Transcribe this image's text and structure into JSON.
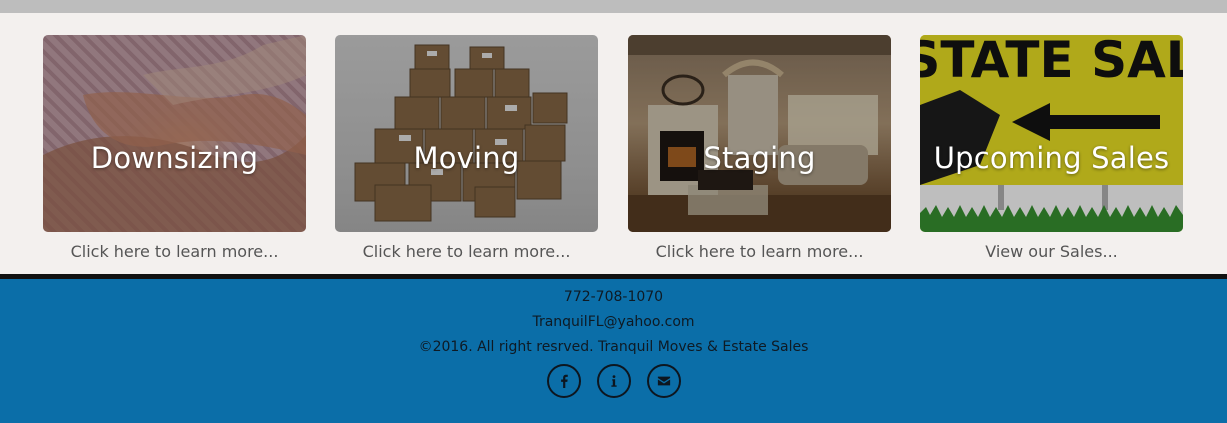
{
  "cards": [
    {
      "title": "Downsizing",
      "caption": "Click here to learn more..."
    },
    {
      "title": "Moving",
      "caption": "Click here to learn more..."
    },
    {
      "title": "Staging",
      "caption": "Click here to learn more..."
    },
    {
      "title": "Upcoming Sales",
      "caption": "View our Sales...",
      "sign_text": "ESTATE SALE"
    }
  ],
  "footer": {
    "phone": "772-708-1070",
    "email": "TranquilFL@yahoo.com",
    "copyright": "©2016. All right resrved. Tranquil Moves & Estate Sales"
  },
  "social_icons": [
    "facebook-icon",
    "info-icon",
    "envelope-icon"
  ],
  "colors": {
    "footer_bg": "#0b6ea8",
    "page_bg": "#f3f0ee",
    "top_bar": "#bdbdbd",
    "estate_sign": "#c9c11e"
  }
}
